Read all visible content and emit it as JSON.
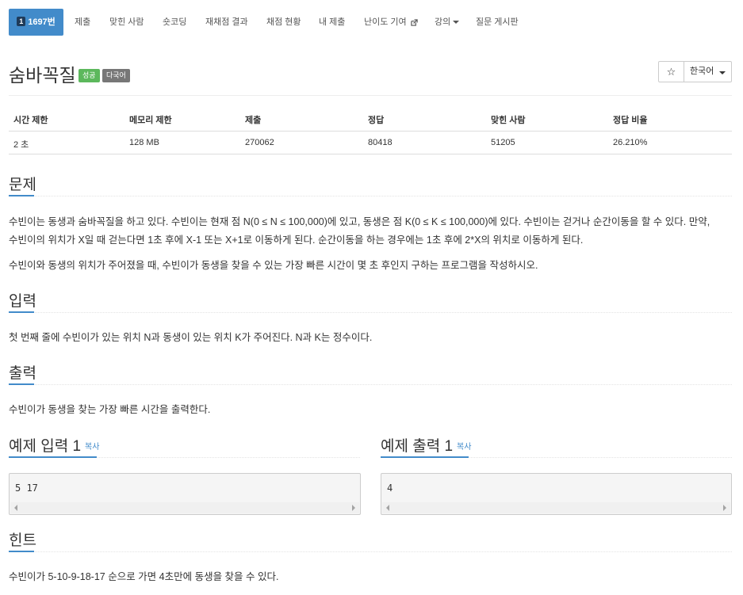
{
  "nav": {
    "problem_no_icon": "1",
    "problem_no": "1697번",
    "items": [
      "제출",
      "맞힌 사람",
      "숏코딩",
      "재채점 결과",
      "채점 현황",
      "내 제출",
      "난이도 기여",
      "강의",
      "질문 게시판"
    ]
  },
  "header": {
    "title": "숨바꼭질",
    "badge_success": "성공",
    "badge_lang": "다국어",
    "star": "☆",
    "language": "한국어"
  },
  "table": {
    "headers": [
      "시간 제한",
      "메모리 제한",
      "제출",
      "정답",
      "맞힌 사람",
      "정답 비율"
    ],
    "row": [
      "2 초",
      "128 MB",
      "270062",
      "80418",
      "51205",
      "26.210%"
    ]
  },
  "problem": {
    "heading": "문제",
    "line1": "수빈이는 동생과 숨바꼭질을 하고 있다. 수빈이는 현재 점 N(0 ≤ N ≤ 100,000)에 있고, 동생은 점 K(0 ≤ K ≤ 100,000)에 있다. 수빈이는 걷거나 순간이동을 할 수 있다. 만약,",
    "line2": "수빈이의 위치가 X일 때 걷는다면 1초 후에 X-1 또는 X+1로 이동하게 된다. 순간이동을 하는 경우에는 1초 후에 2*X의 위치로 이동하게 된다.",
    "line3": "수빈이와 동생의 위치가 주어졌을 때, 수빈이가 동생을 찾을 수 있는 가장 빠른 시간이 몇 초 후인지 구하는 프로그램을 작성하시오."
  },
  "input": {
    "heading": "입력",
    "text": "첫 번째 줄에 수빈이가 있는 위치 N과 동생이 있는 위치 K가 주어진다. N과 K는 정수이다."
  },
  "output": {
    "heading": "출력",
    "text": "수빈이가 동생을 찾는 가장 빠른 시간을 출력한다."
  },
  "samples": {
    "input_heading": "예제 입력 1",
    "output_heading": "예제 출력 1",
    "copy_label": "복사",
    "input_value": "5 17",
    "output_value": "4"
  },
  "hint": {
    "heading": "힌트",
    "text": "수빈이가 5-10-9-18-17 순으로 가면 4초만에 동생을 찾을 수 있다."
  }
}
